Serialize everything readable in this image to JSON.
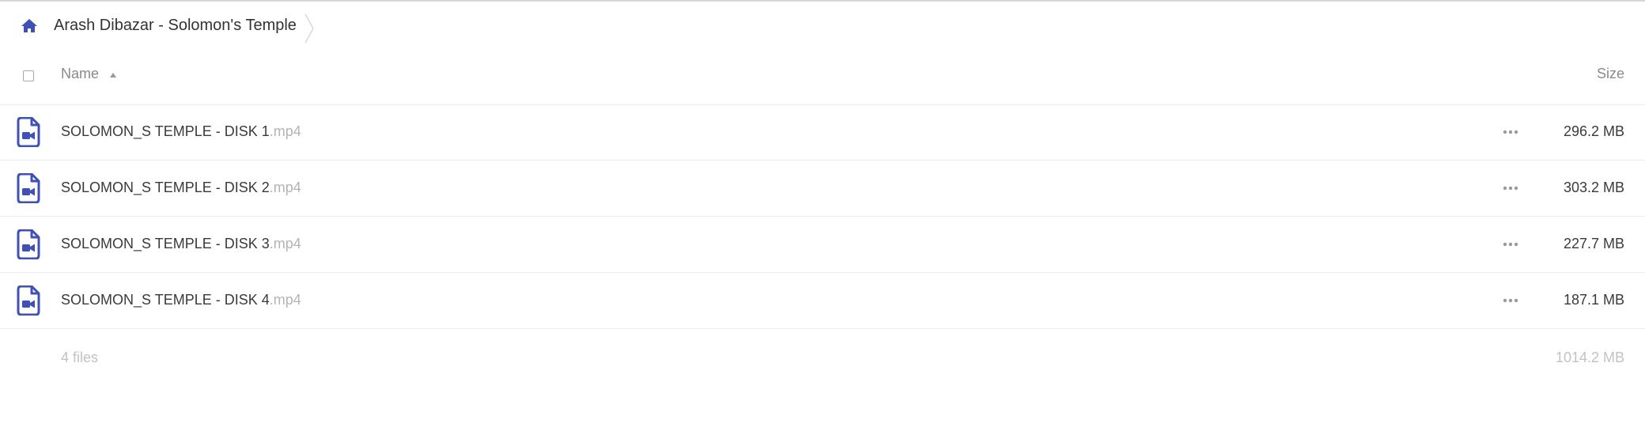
{
  "colors": {
    "accent": "#3f51b5",
    "text": "#333333",
    "muted": "#8a8a8a",
    "extension": "#b4b4b4",
    "divider": "#ececec"
  },
  "breadcrumb": {
    "home_icon": "home-icon",
    "current": "Arash Dibazar - Solomon's Temple"
  },
  "table": {
    "header": {
      "name_label": "Name",
      "sort_icon": "sort-ascending-icon",
      "size_label": "Size"
    },
    "rows": [
      {
        "name": "SOLOMON_S TEMPLE - DISK 1",
        "ext": ".mp4",
        "size": "296.2 MB",
        "icon": "video-file-icon"
      },
      {
        "name": "SOLOMON_S TEMPLE - DISK 2",
        "ext": ".mp4",
        "size": "303.2 MB",
        "icon": "video-file-icon"
      },
      {
        "name": "SOLOMON_S TEMPLE - DISK 3",
        "ext": ".mp4",
        "size": "227.7 MB",
        "icon": "video-file-icon"
      },
      {
        "name": "SOLOMON_S TEMPLE - DISK 4",
        "ext": ".mp4",
        "size": "187.1 MB",
        "icon": "video-file-icon"
      }
    ],
    "footer": {
      "count": "4 files",
      "total": "1014.2 MB"
    }
  }
}
